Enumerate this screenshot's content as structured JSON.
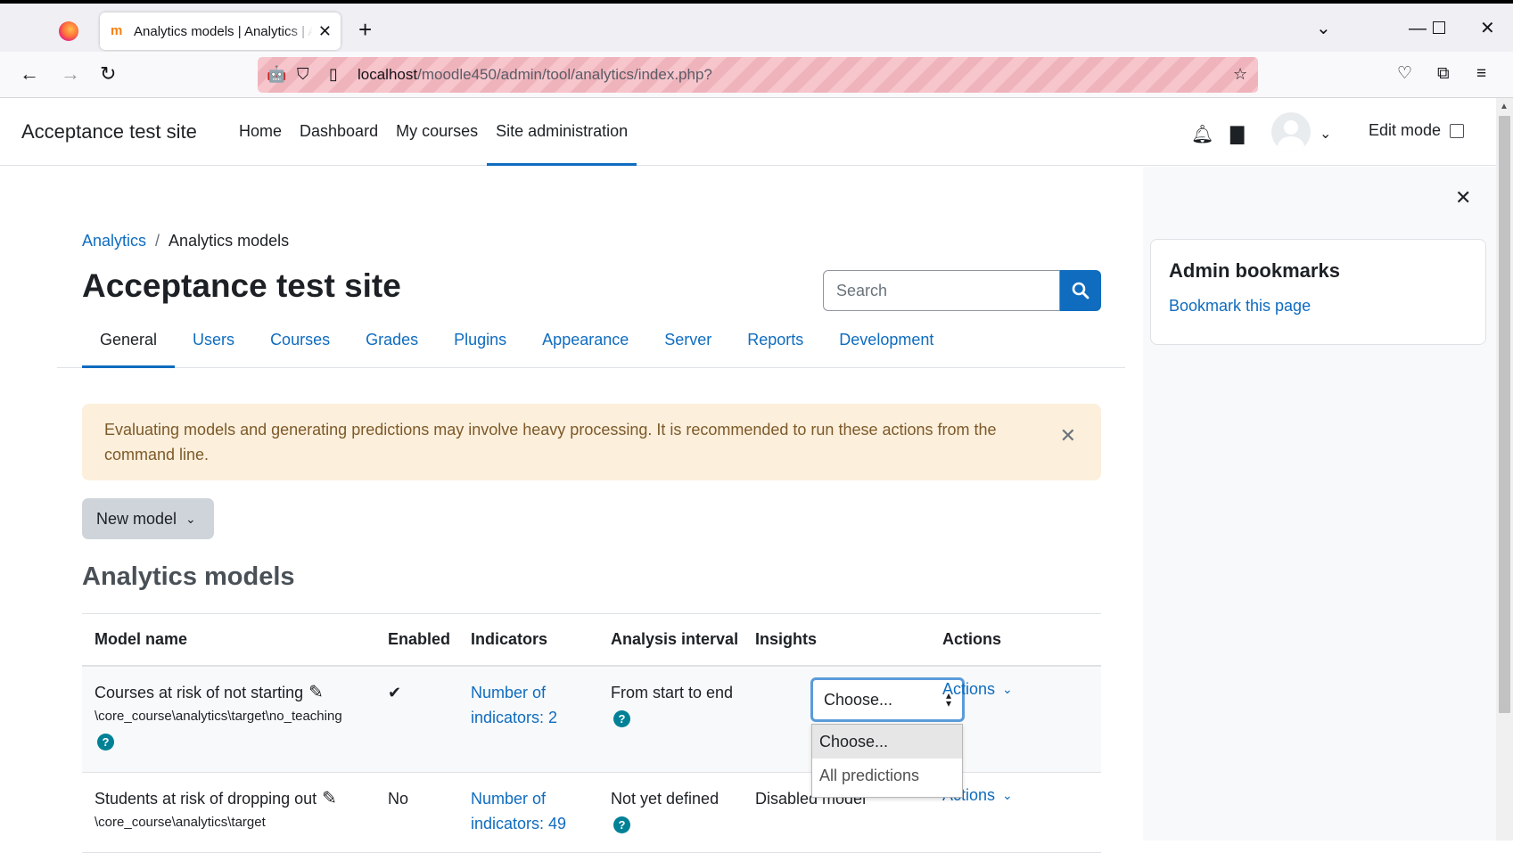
{
  "browser": {
    "tab_title": "Analytics models | Analytics | Acceptance test site",
    "url_host": "localhost",
    "url_path": "/moodle450/admin/tool/analytics/index.php?"
  },
  "header": {
    "site_name": "Acceptance test site",
    "nav": [
      "Home",
      "Dashboard",
      "My courses",
      "Site administration"
    ],
    "edit_mode": "Edit mode"
  },
  "breadcrumb": {
    "parent": "Analytics",
    "current": "Analytics models"
  },
  "page_title": "Acceptance test site",
  "search": {
    "placeholder": "Search"
  },
  "secondary_nav": [
    "General",
    "Users",
    "Courses",
    "Grades",
    "Plugins",
    "Appearance",
    "Server",
    "Reports",
    "Development"
  ],
  "alert": "Evaluating models and generating predictions may involve heavy processing. It is recommended to run these actions from the command line.",
  "new_model": "New model",
  "section_title": "Analytics models",
  "table": {
    "headers": [
      "Model name",
      "Enabled",
      "Indicators",
      "Analysis interval",
      "Insights",
      "Actions"
    ],
    "rows": [
      {
        "name": "Courses at risk of not starting",
        "target": "\\core_course\\analytics\\target\\no_teaching",
        "enabled": "✔",
        "indicators_line1": "Number of",
        "indicators_line2": "indicators: 2",
        "interval": "From start to end",
        "insights": "Choose...",
        "actions": "Actions"
      },
      {
        "name": "Students at risk of dropping out",
        "target": "\\core_course\\analytics\\target",
        "enabled": "No",
        "indicators_line1": "Number of",
        "indicators_line2": "indicators: 49",
        "interval": "Not yet defined",
        "insights": "Disabled model",
        "actions": "Actions"
      }
    ],
    "insights_options": [
      "Choose...",
      "All predictions"
    ]
  },
  "drawer": {
    "block_title": "Admin bookmarks",
    "block_link": "Bookmark this page"
  },
  "colors": {
    "primary": "#0f6cbf",
    "alert_bg": "#fcefdc",
    "help": "#008196"
  }
}
